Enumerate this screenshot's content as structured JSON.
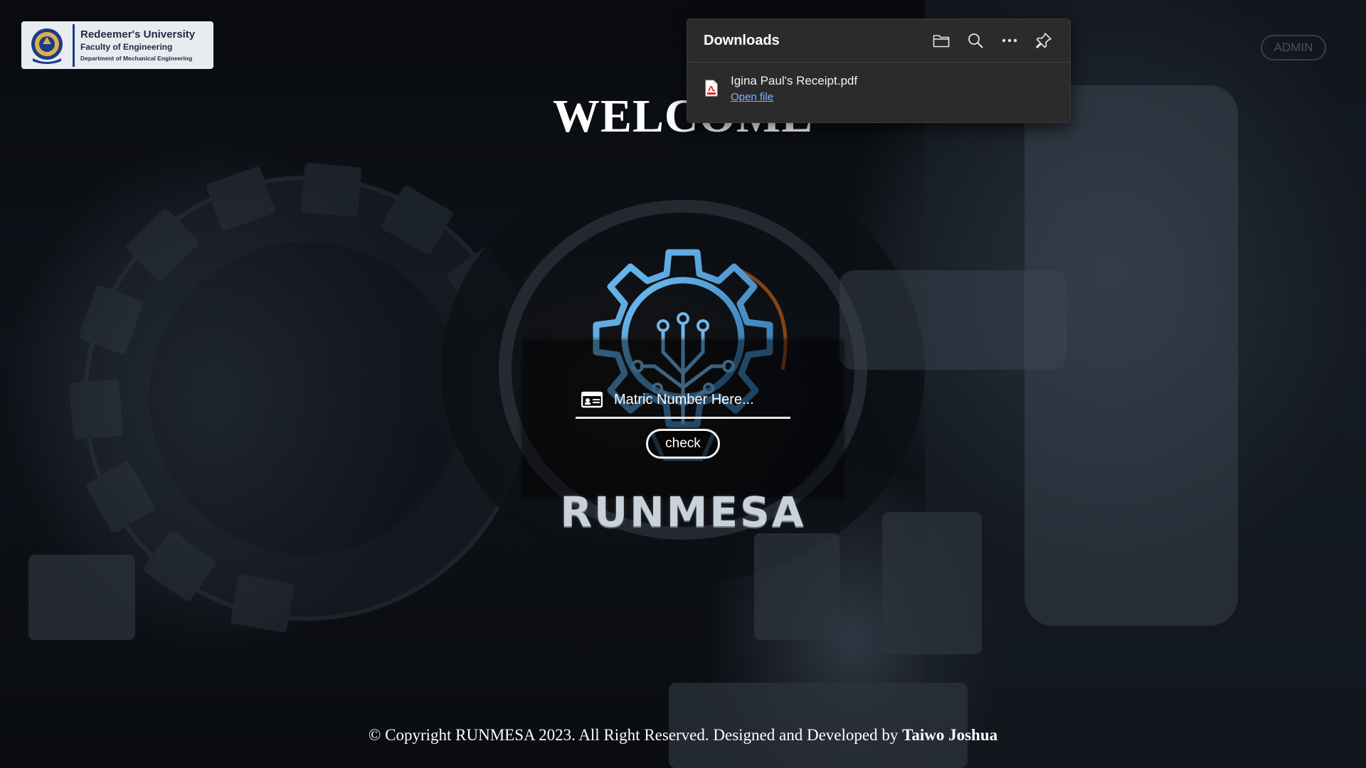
{
  "university": {
    "name": "Redeemer's University",
    "faculty": "Faculty of Engineering",
    "department": "Department of Mechanical Engineering"
  },
  "admin_label": "ADMIN",
  "welcome_text": "WELCOME",
  "login": {
    "matric_placeholder": "Matric Number Here...",
    "check_label": "check"
  },
  "brand": "RUNMESA",
  "footer": {
    "prefix": "© Copyright RUNMESA 2023. All Right Reserved. Designed and Developed by",
    "author": "Taiwo Joshua"
  },
  "downloads": {
    "title": "Downloads",
    "items": [
      {
        "filename": "Igina Paul's Receipt.pdf",
        "action": "Open file"
      }
    ]
  },
  "icons": {
    "folder": "folder-icon",
    "search": "search-icon",
    "more": "more-icon",
    "pin": "pin-icon",
    "pdf": "pdf-file-icon",
    "id_card": "id-card-icon",
    "gear_logo": "gear-circuit-logo"
  },
  "colors": {
    "logo_blue": "#5aa8e6",
    "link_blue": "#7fb3ff",
    "panel_bg": "#2b2b2b",
    "badge_bg": "#e8ecef"
  }
}
